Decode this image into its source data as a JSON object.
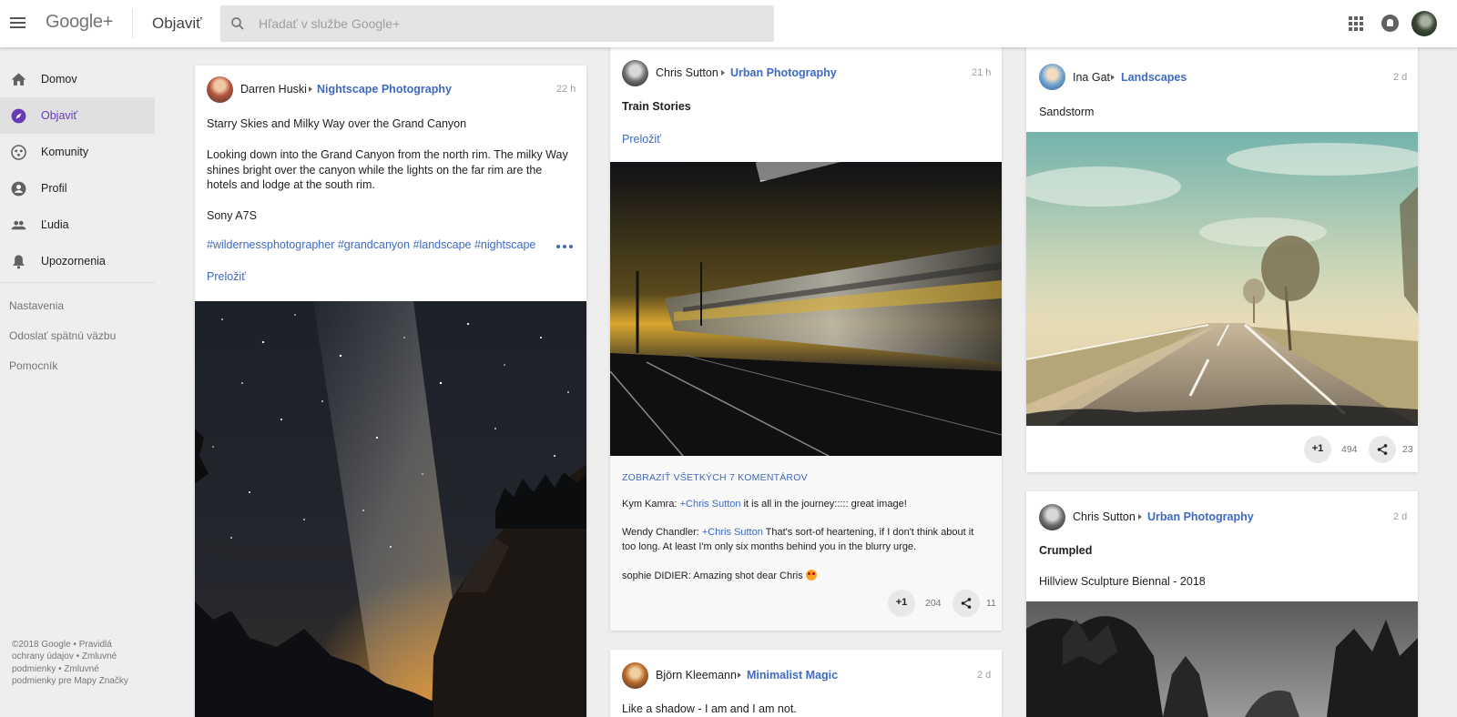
{
  "header": {
    "brand": "Google+",
    "page_title": "Objaviť",
    "search_placeholder": "Hľadať v službe Google+"
  },
  "sidebar": {
    "items": [
      {
        "label": "Domov",
        "icon": "home-icon"
      },
      {
        "label": "Objaviť",
        "icon": "compass-icon",
        "active": true
      },
      {
        "label": "Komunity",
        "icon": "communities-icon"
      },
      {
        "label": "Profil",
        "icon": "profile-icon"
      },
      {
        "label": "Ľudia",
        "icon": "people-icon"
      },
      {
        "label": "Upozornenia",
        "icon": "bell-icon"
      }
    ],
    "links": [
      "Nastavenia",
      "Odoslať spätnú väzbu",
      "Pomocník"
    ],
    "footer": "©2018 Google • Pravidlá ochrany údajov • Zmluvné podmienky • Zmluvné podmienky pre Mapy Značky"
  },
  "posts": {
    "p1": {
      "author": "Darren Huski",
      "community": "Nightscape Photography",
      "time": "22 h",
      "line1": "Starry Skies and Milky Way over the Grand Canyon",
      "line2": "Looking down into the Grand Canyon from the north rim.  The milky Way shines bright over the canyon while the lights on the far rim are the hotels and lodge at the south rim.",
      "line3": "Sony A7S",
      "hashtags": "#wildernessphotographer #grandcanyon #landscape #nightscape",
      "translate": "Preložiť"
    },
    "p2": {
      "author": "Chris Sutton",
      "community": "Urban Photography",
      "time": "21 h",
      "title": "Train Stories",
      "translate": "Preložiť",
      "show_comments": "ZOBRAZIŤ VŠETKÝCH 7 KOMENTÁROV",
      "comments": [
        {
          "name": "Kym Kamra",
          "sep": ": ",
          "plus": "+Chris Sutton",
          "text": " it is all in the journey::::: great image!"
        },
        {
          "name": "Wendy Chandler",
          "sep": ": ",
          "plus": "+Chris Sutton",
          "text": " That's sort-of heartening, if I don't think about it too long. At least I'm only six months behind you in the blurry urge."
        },
        {
          "name": "sophie DIDIER",
          "sep": ": ",
          "text": "Amazing shot dear Chris "
        }
      ],
      "plus_label": "+1",
      "plus_count": "204",
      "share_count": "11"
    },
    "p3": {
      "author": "Björn Kleemann",
      "community": "Minimalist Magic",
      "time": "2 d",
      "text": "Like a shadow - I am and I am not."
    },
    "p4": {
      "author": "Ina Gat",
      "community": "Landscapes",
      "time": "2 d",
      "text": "Sandstorm",
      "plus_label": "+1",
      "plus_count": "494",
      "share_count": "23"
    },
    "p5": {
      "author": "Chris Sutton",
      "community": "Urban Photography",
      "time": "2 d",
      "title": "Crumpled",
      "text": "Hillview Sculpture Biennal - 2018"
    }
  },
  "colors": {
    "link": "#3f69c2",
    "active_nav": "#673ab7",
    "background": "#eeeeee"
  }
}
